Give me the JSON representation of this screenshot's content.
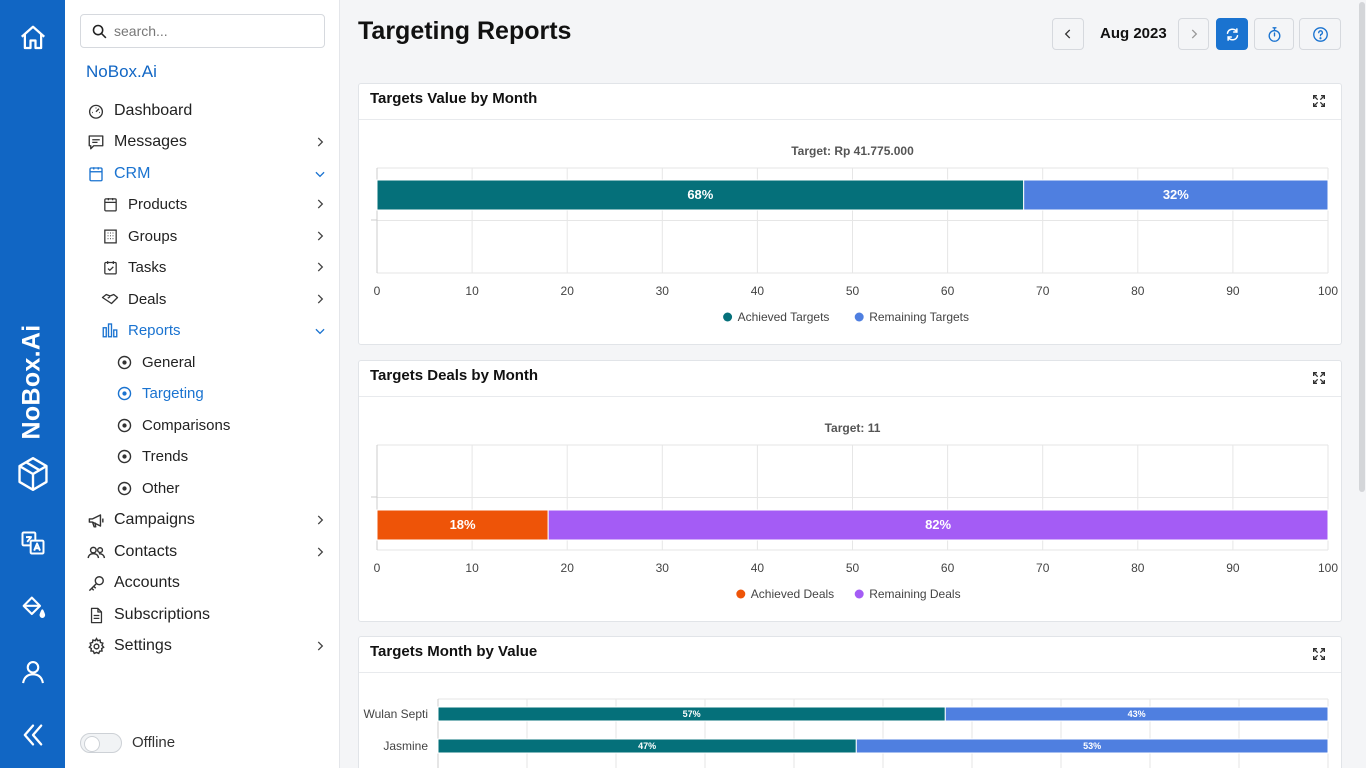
{
  "app": {
    "brand": "NoBox.Ai",
    "org_name": "NoBox.Ai"
  },
  "search": {
    "placeholder": "search..."
  },
  "nav": {
    "dashboard": "Dashboard",
    "messages": "Messages",
    "crm": "CRM",
    "products": "Products",
    "groups": "Groups",
    "tasks": "Tasks",
    "deals": "Deals",
    "reports": "Reports",
    "general": "General",
    "targeting": "Targeting",
    "comparisons": "Comparisons",
    "trends": "Trends",
    "other": "Other",
    "campaigns": "Campaigns",
    "contacts": "Contacts",
    "accounts": "Accounts",
    "subscriptions": "Subscriptions",
    "settings": "Settings"
  },
  "status": {
    "offline_label": "Offline"
  },
  "header": {
    "title": "Targeting Reports",
    "month": "Aug 2023"
  },
  "colors": {
    "brand": "#1166c4",
    "teal": "#05707a",
    "blue": "#4f7fe0",
    "orange": "#ee5408",
    "purple": "#a45cf5"
  },
  "chart_data": [
    {
      "type": "bar",
      "title": "Targets Value by Month",
      "subtitle": "Target: Rp 41.775.000",
      "orientation": "horizontal",
      "stacked": true,
      "categories": [
        ""
      ],
      "series": [
        {
          "name": "Achieved Targets",
          "values": [
            68
          ],
          "color": "#05707a"
        },
        {
          "name": "Remaining Targets",
          "values": [
            32
          ],
          "color": "#4f7fe0"
        }
      ],
      "xlim": [
        0,
        100
      ],
      "xticks": [
        0,
        10,
        20,
        30,
        40,
        50,
        60,
        70,
        80,
        90,
        100
      ],
      "data_labels": [
        "68%",
        "32%"
      ],
      "legend": "bottom-center",
      "grid": true
    },
    {
      "type": "bar",
      "title": "Targets Deals by Month",
      "subtitle": "Target:  11",
      "orientation": "horizontal",
      "stacked": true,
      "categories": [
        ""
      ],
      "series": [
        {
          "name": "Achieved Deals",
          "values": [
            18
          ],
          "color": "#ee5408"
        },
        {
          "name": "Remaining Deals",
          "values": [
            82
          ],
          "color": "#a45cf5"
        }
      ],
      "xlim": [
        0,
        100
      ],
      "xticks": [
        0,
        10,
        20,
        30,
        40,
        50,
        60,
        70,
        80,
        90,
        100
      ],
      "data_labels": [
        "18%",
        "82%"
      ],
      "legend": "bottom-center",
      "grid": true
    },
    {
      "type": "bar",
      "title": "Targets Month by Value",
      "orientation": "horizontal",
      "stacked": true,
      "categories": [
        "Wulan Septi",
        "Jasmine"
      ],
      "series": [
        {
          "name": "",
          "values": [
            57,
            47
          ],
          "color": "#05707a"
        },
        {
          "name": "",
          "values": [
            43,
            53
          ],
          "color": "#4f7fe0"
        }
      ],
      "xlim": [
        0,
        100
      ],
      "data_labels": [
        [
          "57%",
          "43%"
        ],
        [
          "47%",
          "53%"
        ]
      ],
      "grid": true
    }
  ]
}
